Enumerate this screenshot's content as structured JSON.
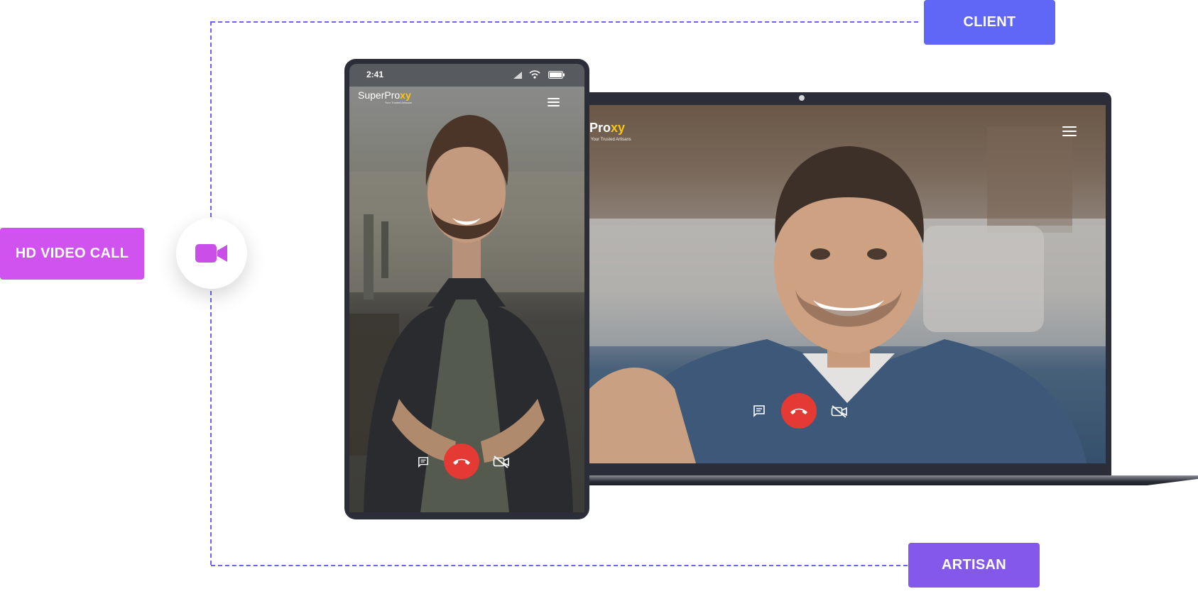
{
  "labels": {
    "client": "CLIENT",
    "artisan": "ARTISAN",
    "hd_video_call": "HD VIDEO CALL"
  },
  "phone": {
    "status_time": "2:41",
    "logo_text": "SuperPro",
    "logo_accent": "xy",
    "tagline": "Your Trusted Artisans"
  },
  "laptop": {
    "logo_partial": "Pro",
    "logo_accent": "xy",
    "tagline": "Your Trusted Artisans"
  },
  "icons": {
    "video_circle": "video-camera-icon",
    "call_controls": [
      "chat-icon",
      "hang-up-icon",
      "video-off-icon"
    ],
    "menu": "hamburger-icon"
  },
  "colors": {
    "client": "#6066f5",
    "artisan": "#8458eb",
    "hd_video_call": "#d053ef",
    "connector": "#6c63f5",
    "hangup": "#e43a33",
    "logo_accent": "#f5c518"
  }
}
